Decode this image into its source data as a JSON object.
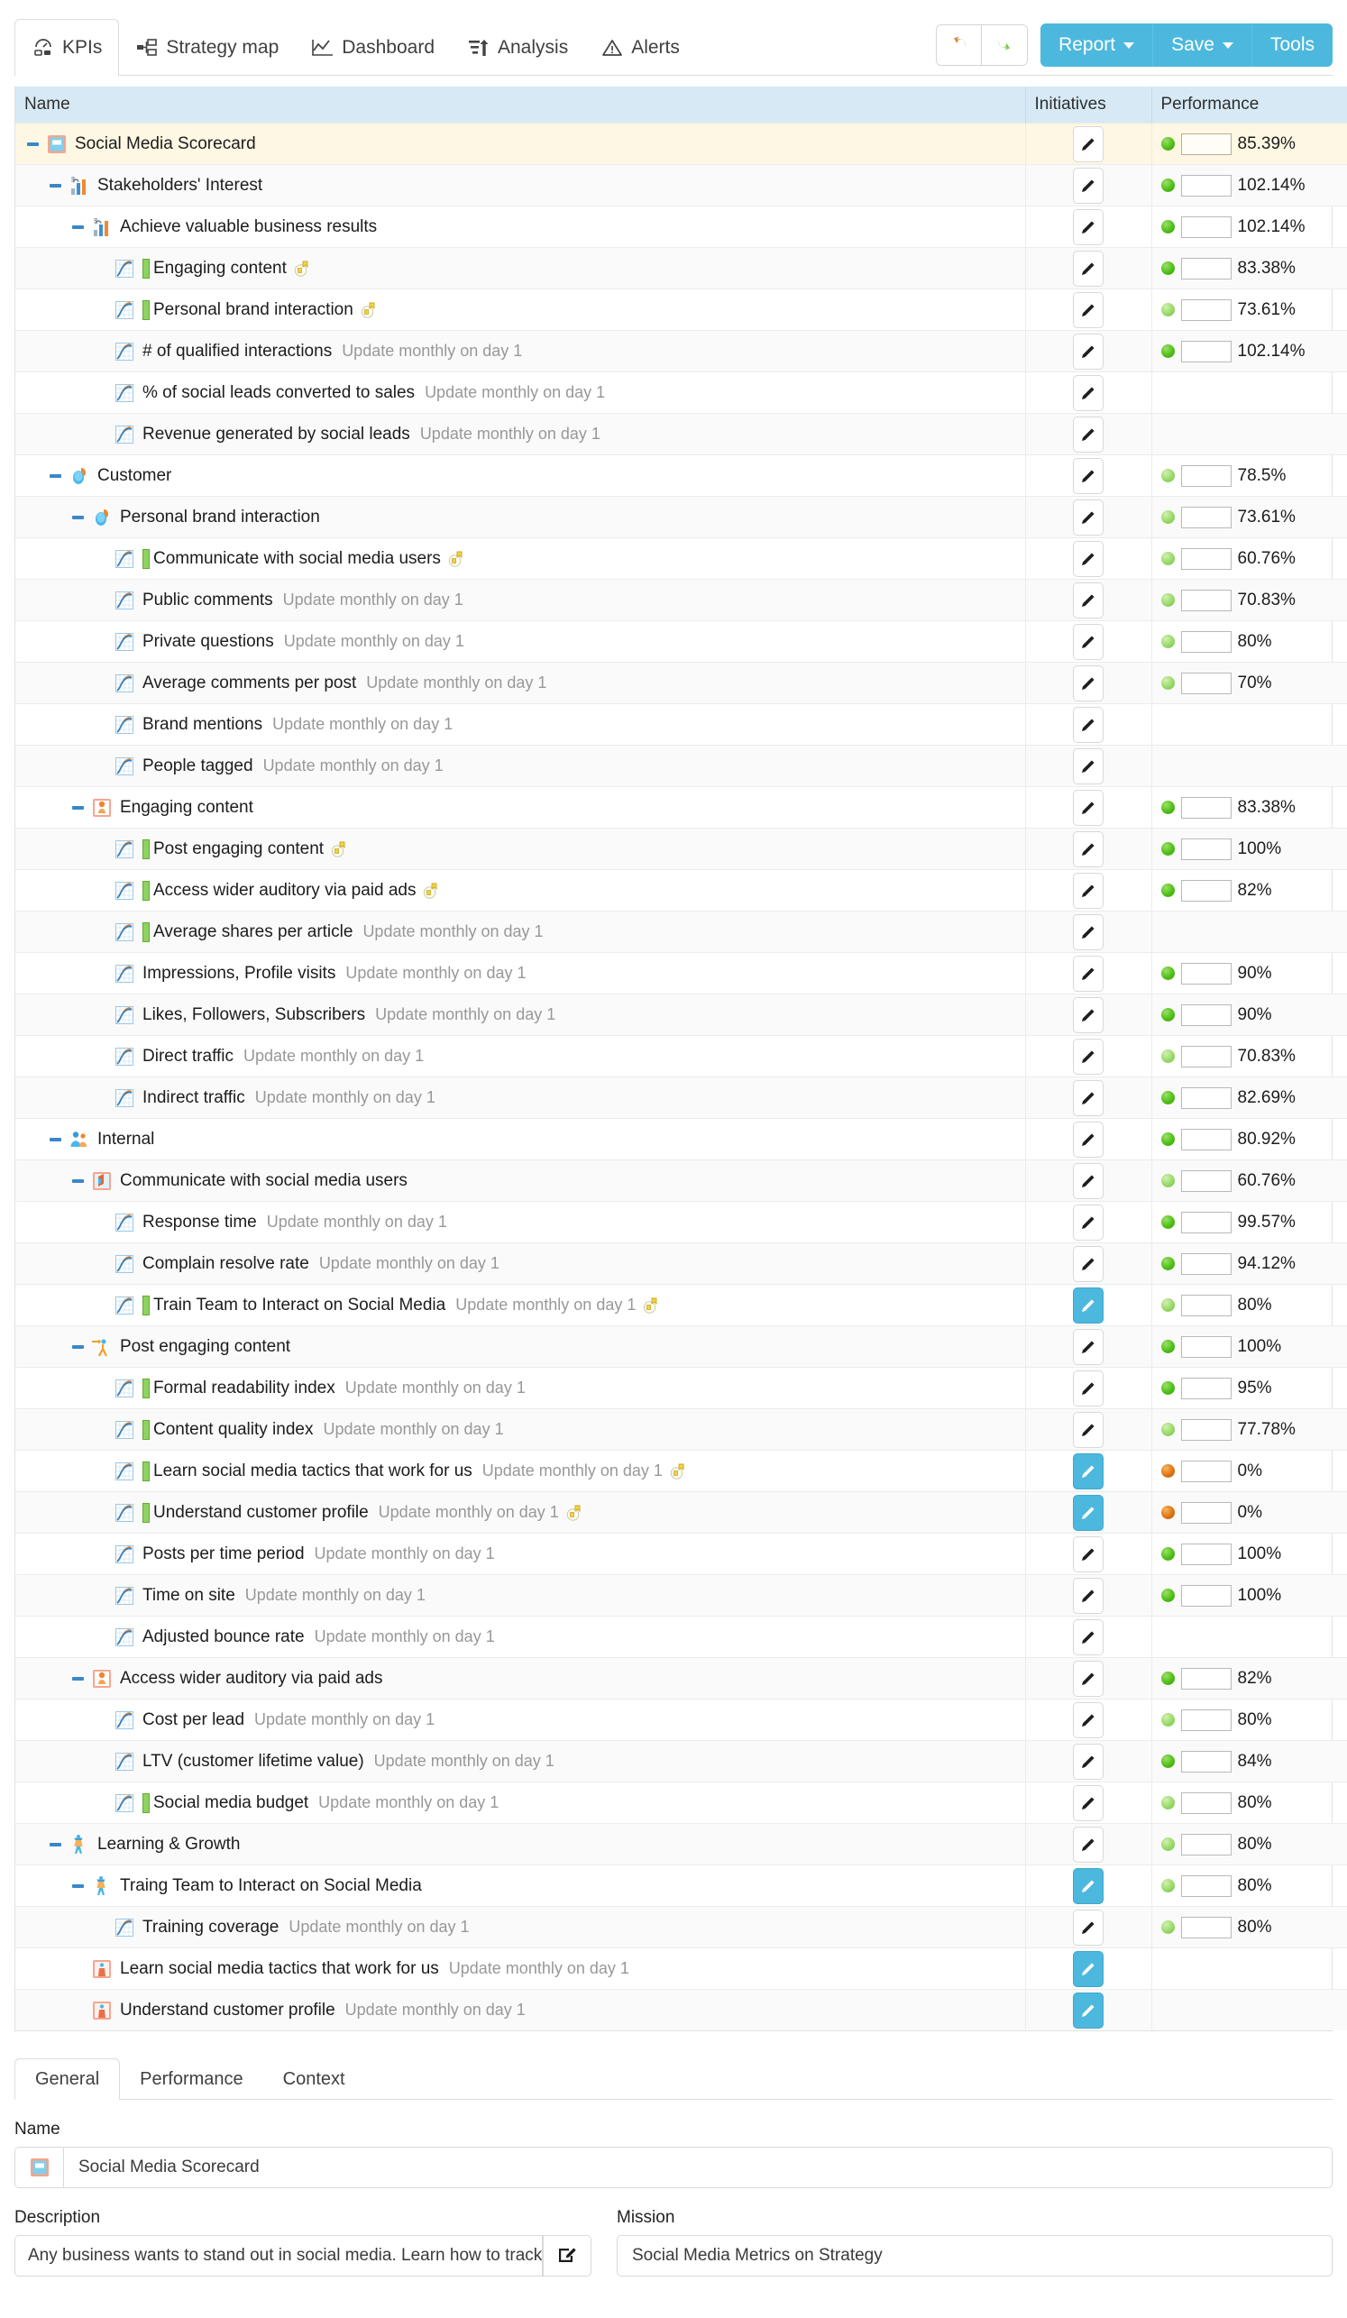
{
  "toolbar": {
    "tabs": [
      {
        "label": "KPIs",
        "icon": "gauge-icon",
        "active": true
      },
      {
        "label": "Strategy map",
        "icon": "strategy-map-icon",
        "active": false
      },
      {
        "label": "Dashboard",
        "icon": "dashboard-chart-icon",
        "active": false
      },
      {
        "label": "Analysis",
        "icon": "analysis-bars-icon",
        "active": false
      },
      {
        "label": "Alerts",
        "icon": "alert-triangle-icon",
        "active": false
      }
    ],
    "undo_label": "Undo",
    "redo_label": "Redo",
    "report_label": "Report",
    "save_label": "Save",
    "tools_label": "Tools",
    "accent_color": "#4db8dd"
  },
  "grid": {
    "headers": [
      "Name",
      "Initiatives",
      "Performance"
    ],
    "rows": [
      {
        "indent": 0,
        "twisty": "minus",
        "icon": "scorecard-icon",
        "name": "Social Media Scorecard",
        "sub": "",
        "bar": false,
        "medal": false,
        "init_on": false,
        "dot": "green",
        "perf": "85.39%",
        "root": true
      },
      {
        "indent": 1,
        "twisty": "minus",
        "icon": "stakeholder-icon",
        "name": "Stakeholders' Interest",
        "sub": "",
        "bar": false,
        "medal": false,
        "init_on": false,
        "dot": "green",
        "perf": "102.14%",
        "root": false
      },
      {
        "indent": 2,
        "twisty": "minus",
        "icon": "stakeholder-icon",
        "name": "Achieve valuable business results",
        "sub": "",
        "bar": false,
        "medal": false,
        "init_on": false,
        "dot": "green",
        "perf": "102.14%",
        "root": false
      },
      {
        "indent": 3,
        "twisty": "none",
        "icon": "kpi-chart-icon",
        "name": "Engaging content",
        "sub": "",
        "bar": true,
        "medal": true,
        "init_on": false,
        "dot": "green",
        "perf": "83.38%",
        "root": false
      },
      {
        "indent": 3,
        "twisty": "none",
        "icon": "kpi-chart-icon",
        "name": "Personal brand interaction",
        "sub": "",
        "bar": true,
        "medal": true,
        "init_on": false,
        "dot": "lightgreen",
        "perf": "73.61%",
        "root": false
      },
      {
        "indent": 3,
        "twisty": "none",
        "icon": "kpi-chart-icon",
        "name": "# of qualified interactions",
        "sub": "Update monthly on day 1",
        "bar": false,
        "medal": false,
        "init_on": false,
        "dot": "green",
        "perf": "102.14%",
        "root": false
      },
      {
        "indent": 3,
        "twisty": "none",
        "icon": "kpi-chart-icon",
        "name": "% of social leads converted to sales",
        "sub": "Update monthly on day 1",
        "bar": false,
        "medal": false,
        "init_on": false,
        "dot": "",
        "perf": "",
        "root": false
      },
      {
        "indent": 3,
        "twisty": "none",
        "icon": "kpi-chart-icon",
        "name": "Revenue generated by social leads",
        "sub": "Update monthly on day 1",
        "bar": false,
        "medal": false,
        "init_on": false,
        "dot": "",
        "perf": "",
        "root": false
      },
      {
        "indent": 1,
        "twisty": "minus",
        "icon": "customer-icon",
        "name": "Customer",
        "sub": "",
        "bar": false,
        "medal": false,
        "init_on": false,
        "dot": "lightgreen",
        "perf": "78.5%",
        "root": false
      },
      {
        "indent": 2,
        "twisty": "minus",
        "icon": "customer-icon",
        "name": "Personal brand interaction",
        "sub": "",
        "bar": false,
        "medal": false,
        "init_on": false,
        "dot": "lightgreen",
        "perf": "73.61%",
        "root": false
      },
      {
        "indent": 3,
        "twisty": "none",
        "icon": "kpi-chart-icon",
        "name": "Communicate with social media users",
        "sub": "",
        "bar": true,
        "medal": true,
        "init_on": false,
        "dot": "lightgreen",
        "perf": "60.76%",
        "root": false
      },
      {
        "indent": 3,
        "twisty": "none",
        "icon": "kpi-chart-icon",
        "name": "Public comments",
        "sub": "Update monthly on day 1",
        "bar": false,
        "medal": false,
        "init_on": false,
        "dot": "lightgreen",
        "perf": "70.83%",
        "root": false
      },
      {
        "indent": 3,
        "twisty": "none",
        "icon": "kpi-chart-icon",
        "name": "Private questions",
        "sub": "Update monthly on day 1",
        "bar": false,
        "medal": false,
        "init_on": false,
        "dot": "lightgreen",
        "perf": "80%",
        "root": false
      },
      {
        "indent": 3,
        "twisty": "none",
        "icon": "kpi-chart-icon",
        "name": "Average comments per post",
        "sub": "Update monthly on day 1",
        "bar": false,
        "medal": false,
        "init_on": false,
        "dot": "lightgreen",
        "perf": "70%",
        "root": false
      },
      {
        "indent": 3,
        "twisty": "none",
        "icon": "kpi-chart-icon",
        "name": "Brand mentions",
        "sub": "Update monthly on day 1",
        "bar": false,
        "medal": false,
        "init_on": false,
        "dot": "",
        "perf": "",
        "root": false
      },
      {
        "indent": 3,
        "twisty": "none",
        "icon": "kpi-chart-icon",
        "name": "People tagged",
        "sub": "Update monthly on day 1",
        "bar": false,
        "medal": false,
        "init_on": false,
        "dot": "",
        "perf": "",
        "root": false
      },
      {
        "indent": 2,
        "twisty": "minus",
        "icon": "objective-orange-icon",
        "name": "Engaging content",
        "sub": "",
        "bar": false,
        "medal": false,
        "init_on": false,
        "dot": "green",
        "perf": "83.38%",
        "root": false
      },
      {
        "indent": 3,
        "twisty": "none",
        "icon": "kpi-chart-icon",
        "name": "Post engaging content",
        "sub": "",
        "bar": true,
        "medal": true,
        "init_on": false,
        "dot": "green",
        "perf": "100%",
        "root": false
      },
      {
        "indent": 3,
        "twisty": "none",
        "icon": "kpi-chart-icon",
        "name": "Access wider auditory via paid ads",
        "sub": "",
        "bar": true,
        "medal": true,
        "init_on": false,
        "dot": "green",
        "perf": "82%",
        "root": false
      },
      {
        "indent": 3,
        "twisty": "none",
        "icon": "kpi-chart-icon",
        "name": "Average shares per article",
        "sub": "Update monthly on day 1",
        "bar": true,
        "medal": false,
        "init_on": false,
        "dot": "",
        "perf": "",
        "root": false
      },
      {
        "indent": 3,
        "twisty": "none",
        "icon": "kpi-chart-icon",
        "name": "Impressions, Profile visits",
        "sub": "Update monthly on day 1",
        "bar": false,
        "medal": false,
        "init_on": false,
        "dot": "green",
        "perf": "90%",
        "root": false
      },
      {
        "indent": 3,
        "twisty": "none",
        "icon": "kpi-chart-icon",
        "name": "Likes, Followers, Subscribers",
        "sub": "Update monthly on day 1",
        "bar": false,
        "medal": false,
        "init_on": false,
        "dot": "green",
        "perf": "90%",
        "root": false
      },
      {
        "indent": 3,
        "twisty": "none",
        "icon": "kpi-chart-icon",
        "name": "Direct traffic",
        "sub": "Update monthly on day 1",
        "bar": false,
        "medal": false,
        "init_on": false,
        "dot": "lightgreen",
        "perf": "70.83%",
        "root": false
      },
      {
        "indent": 3,
        "twisty": "none",
        "icon": "kpi-chart-icon",
        "name": "Indirect traffic",
        "sub": "Update monthly on day 1",
        "bar": false,
        "medal": false,
        "init_on": false,
        "dot": "green",
        "perf": "82.69%",
        "root": false
      },
      {
        "indent": 1,
        "twisty": "minus",
        "icon": "internal-people-icon",
        "name": "Internal",
        "sub": "",
        "bar": false,
        "medal": false,
        "init_on": false,
        "dot": "green",
        "perf": "80.92%",
        "root": false
      },
      {
        "indent": 2,
        "twisty": "minus",
        "icon": "communicate-icon",
        "name": "Communicate with social media users",
        "sub": "",
        "bar": false,
        "medal": false,
        "init_on": false,
        "dot": "lightgreen",
        "perf": "60.76%",
        "root": false
      },
      {
        "indent": 3,
        "twisty": "none",
        "icon": "kpi-chart-icon",
        "name": "Response time",
        "sub": "Update monthly on day 1",
        "bar": false,
        "medal": false,
        "init_on": false,
        "dot": "green",
        "perf": "99.57%",
        "root": false
      },
      {
        "indent": 3,
        "twisty": "none",
        "icon": "kpi-chart-icon",
        "name": "Complain resolve rate",
        "sub": "Update monthly on day 1",
        "bar": false,
        "medal": false,
        "init_on": false,
        "dot": "green",
        "perf": "94.12%",
        "root": false
      },
      {
        "indent": 3,
        "twisty": "none",
        "icon": "kpi-chart-icon",
        "name": "Train Team to Interact on Social Media",
        "sub": "Update monthly on day 1",
        "bar": true,
        "medal": true,
        "init_on": true,
        "dot": "lightgreen",
        "perf": "80%",
        "root": false
      },
      {
        "indent": 2,
        "twisty": "minus",
        "icon": "post-content-icon",
        "name": "Post engaging content",
        "sub": "",
        "bar": false,
        "medal": false,
        "init_on": false,
        "dot": "green",
        "perf": "100%",
        "root": false
      },
      {
        "indent": 3,
        "twisty": "none",
        "icon": "kpi-chart-icon",
        "name": "Formal readability index",
        "sub": "Update monthly on day 1",
        "bar": true,
        "medal": false,
        "init_on": false,
        "dot": "green",
        "perf": "95%",
        "root": false
      },
      {
        "indent": 3,
        "twisty": "none",
        "icon": "kpi-chart-icon",
        "name": "Content quality index",
        "sub": "Update monthly on day 1",
        "bar": true,
        "medal": false,
        "init_on": false,
        "dot": "lightgreen",
        "perf": "77.78%",
        "root": false
      },
      {
        "indent": 3,
        "twisty": "none",
        "icon": "kpi-chart-icon",
        "name": "Learn social media tactics that work for us",
        "sub": "Update monthly on day 1",
        "bar": true,
        "medal": true,
        "init_on": true,
        "dot": "orange",
        "perf": "0%",
        "root": false
      },
      {
        "indent": 3,
        "twisty": "none",
        "icon": "kpi-chart-icon",
        "name": "Understand customer profile",
        "sub": "Update monthly on day 1",
        "bar": true,
        "medal": true,
        "init_on": true,
        "dot": "orange",
        "perf": "0%",
        "root": false
      },
      {
        "indent": 3,
        "twisty": "none",
        "icon": "kpi-chart-icon",
        "name": "Posts per time period",
        "sub": "Update monthly on day 1",
        "bar": false,
        "medal": false,
        "init_on": false,
        "dot": "green",
        "perf": "100%",
        "root": false
      },
      {
        "indent": 3,
        "twisty": "none",
        "icon": "kpi-chart-icon",
        "name": "Time on site",
        "sub": "Update monthly on day 1",
        "bar": false,
        "medal": false,
        "init_on": false,
        "dot": "green",
        "perf": "100%",
        "root": false
      },
      {
        "indent": 3,
        "twisty": "none",
        "icon": "kpi-chart-icon",
        "name": "Adjusted bounce rate",
        "sub": "Update monthly on day 1",
        "bar": false,
        "medal": false,
        "init_on": false,
        "dot": "",
        "perf": "",
        "root": false
      },
      {
        "indent": 2,
        "twisty": "minus",
        "icon": "objective-orange-icon",
        "name": "Access wider auditory via paid ads",
        "sub": "",
        "bar": false,
        "medal": false,
        "init_on": false,
        "dot": "green",
        "perf": "82%",
        "root": false
      },
      {
        "indent": 3,
        "twisty": "none",
        "icon": "kpi-chart-icon",
        "name": "Cost per lead",
        "sub": "Update monthly on day 1",
        "bar": false,
        "medal": false,
        "init_on": false,
        "dot": "lightgreen",
        "perf": "80%",
        "root": false
      },
      {
        "indent": 3,
        "twisty": "none",
        "icon": "kpi-chart-icon",
        "name": "LTV (customer lifetime value)",
        "sub": "Update monthly on day 1",
        "bar": false,
        "medal": false,
        "init_on": false,
        "dot": "green",
        "perf": "84%",
        "root": false
      },
      {
        "indent": 3,
        "twisty": "none",
        "icon": "kpi-chart-icon",
        "name": "Social media budget",
        "sub": "Update monthly on day 1",
        "bar": true,
        "medal": false,
        "init_on": false,
        "dot": "lightgreen",
        "perf": "80%",
        "root": false
      },
      {
        "indent": 1,
        "twisty": "minus",
        "icon": "learning-icon",
        "name": "Learning & Growth",
        "sub": "",
        "bar": false,
        "medal": false,
        "init_on": false,
        "dot": "lightgreen",
        "perf": "80%",
        "root": false
      },
      {
        "indent": 2,
        "twisty": "minus",
        "icon": "learning-icon",
        "name": "Traing Team to Interact on Social Media",
        "sub": "",
        "bar": false,
        "medal": false,
        "init_on": true,
        "dot": "lightgreen",
        "perf": "80%",
        "root": false
      },
      {
        "indent": 3,
        "twisty": "none",
        "icon": "kpi-chart-icon",
        "name": "Training coverage",
        "sub": "Update monthly on day 1",
        "bar": false,
        "medal": false,
        "init_on": false,
        "dot": "lightgreen",
        "perf": "80%",
        "root": false
      },
      {
        "indent": 2,
        "twisty": "none",
        "icon": "initiative-icon",
        "name": "Learn social media tactics that work for us",
        "sub": "Update monthly on day 1",
        "bar": false,
        "medal": false,
        "init_on": true,
        "dot": "",
        "perf": "",
        "root": false
      },
      {
        "indent": 2,
        "twisty": "none",
        "icon": "initiative-icon",
        "name": "Understand customer profile",
        "sub": "Update monthly on day 1",
        "bar": false,
        "medal": false,
        "init_on": true,
        "dot": "",
        "perf": "",
        "root": false
      }
    ]
  },
  "details": {
    "tabs": [
      {
        "label": "General",
        "active": true
      },
      {
        "label": "Performance",
        "active": false
      },
      {
        "label": "Context",
        "active": false
      }
    ],
    "name_label": "Name",
    "name_value": "Social Media Scorecard",
    "description_label": "Description",
    "description_value": "Any business wants to stand out in social media. Learn how to track the pulse of",
    "mission_label": "Mission",
    "mission_value": "Social Media Metrics on Strategy"
  }
}
